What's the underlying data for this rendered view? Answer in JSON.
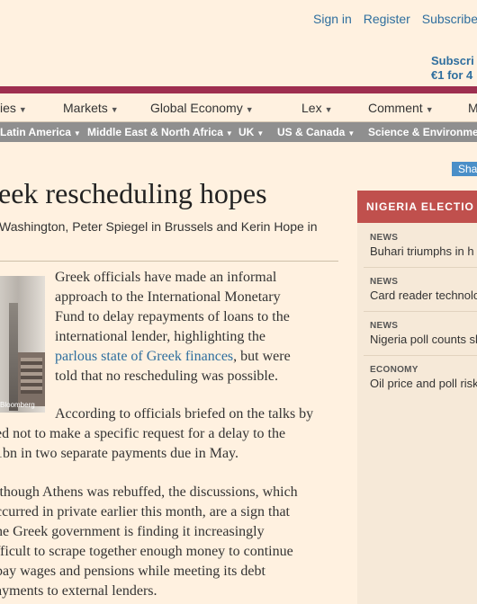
{
  "header": {
    "account_links": [
      "Sign in",
      "Register",
      "Subscribe"
    ],
    "promo_line1": "Subscri",
    "promo_line2": "€1 for 4"
  },
  "main_nav": {
    "items": [
      {
        "label": "ies",
        "chevron": true
      },
      {
        "label": "Markets",
        "chevron": true
      },
      {
        "label": "Global Economy",
        "chevron": true
      },
      {
        "label": "Lex",
        "chevron": true
      },
      {
        "label": "Comment",
        "chevron": true
      },
      {
        "label": "M",
        "chevron": false
      }
    ]
  },
  "sub_nav": {
    "items": [
      {
        "label": "Latin America",
        "chevron": true
      },
      {
        "label": "Middle East & North Africa",
        "chevron": true
      },
      {
        "label": "UK",
        "chevron": true
      },
      {
        "label": "US & Canada",
        "chevron": true
      },
      {
        "label": "Science & Environmen",
        "chevron": false
      }
    ]
  },
  "share_label": "Sha",
  "article": {
    "headline": "eek rescheduling hopes",
    "byline": "Washington, Peter Spiegel in Brussels and Kerin Hope in",
    "photo_credit": "Bloomberg",
    "para1": {
      "lines": [
        "Greek officials have made an informal",
        "approach to the International Monetary",
        "Fund to delay repayments of loans to the",
        "international lender, highlighting the"
      ],
      "link_text": "parlous state of Greek finances",
      "after_link": ", but were",
      "last_line": "told that no rescheduling was possible."
    },
    "para2": {
      "lines": [
        "According to officials briefed on the talks by",
        "ed not to make a specific request for a delay to the",
        "1bn in two separate payments due in May."
      ]
    },
    "para3": {
      "lines": [
        "lthough Athens was rebuffed, the discussions, which",
        "ccurred in private earlier this month, are a sign that",
        "he Greek government is finding it increasingly",
        "fficult to scrape together enough money to continue",
        " pay wages and pensions while meeting its debt",
        "ayments to external lenders."
      ]
    }
  },
  "sidebar": {
    "heading": "NIGERIA ELECTIO",
    "stories": [
      {
        "tag": "NEWS",
        "title": "Buhari triumphs in h"
      },
      {
        "tag": "NEWS",
        "title": "Card reader technolo"
      },
      {
        "tag": "NEWS",
        "title": "Nigeria poll counts sh"
      },
      {
        "tag": "ECONOMY",
        "title": "Oil price and poll risk"
      }
    ]
  },
  "colors": {
    "background": "#fff1e0",
    "topbar": "#9e2f50",
    "subnav": "#8f8f8f",
    "link": "#2e6e9e",
    "sidebar_heading": "#c0504d"
  }
}
